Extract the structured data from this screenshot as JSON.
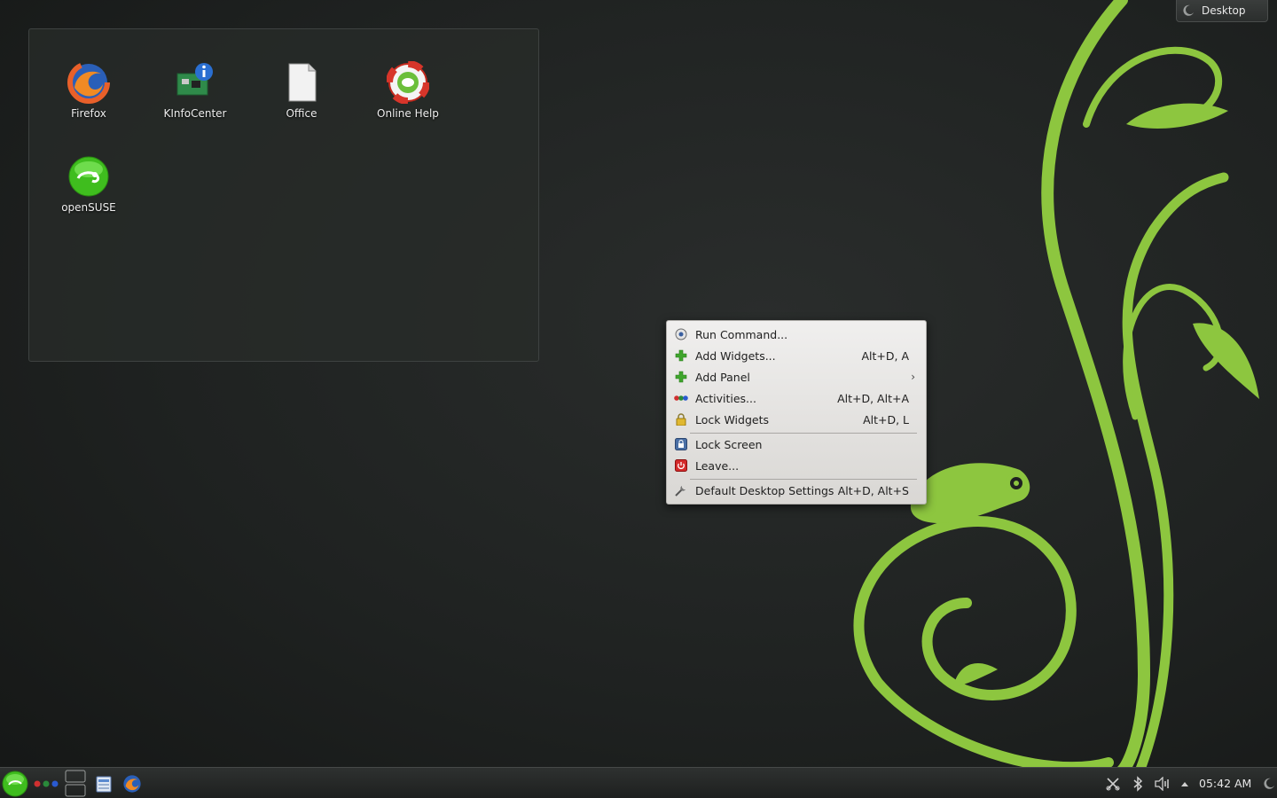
{
  "toolbox": {
    "label": "Desktop"
  },
  "desktop_icons": [
    {
      "label": "Firefox",
      "icon": "firefox-icon"
    },
    {
      "label": "KInfoCenter",
      "icon": "kinfocenter-icon"
    },
    {
      "label": "Office",
      "icon": "office-document-icon"
    },
    {
      "label": "Online Help",
      "icon": "help-lifebuoy-icon"
    },
    {
      "label": "openSUSE",
      "icon": "opensuse-icon"
    }
  ],
  "context_menu": {
    "items": [
      {
        "label": "Run Command...",
        "shortcut": "",
        "icon": "run-command-icon"
      },
      {
        "label": "Add Widgets...",
        "shortcut": "Alt+D, A",
        "icon": "add-icon"
      },
      {
        "label": "Add Panel",
        "shortcut": "",
        "icon": "add-icon",
        "submenu": true
      },
      {
        "label": "Activities...",
        "shortcut": "Alt+D, Alt+A",
        "icon": "activities-icon"
      },
      {
        "label": "Lock Widgets",
        "shortcut": "Alt+D, L",
        "icon": "lock-icon"
      },
      {
        "label": "Lock Screen",
        "shortcut": "",
        "icon": "lock-screen-icon"
      },
      {
        "label": "Leave...",
        "shortcut": "",
        "icon": "leave-icon"
      },
      {
        "label": "Default Desktop Settings",
        "shortcut": "Alt+D, Alt+S",
        "icon": "settings-tools-icon"
      }
    ],
    "submenu_arrow": "›"
  },
  "taskbar": {
    "clock": "05:42 AM"
  },
  "colors": {
    "accent_green": "#8dc63f",
    "menu_bg": "#e6e4e1"
  }
}
